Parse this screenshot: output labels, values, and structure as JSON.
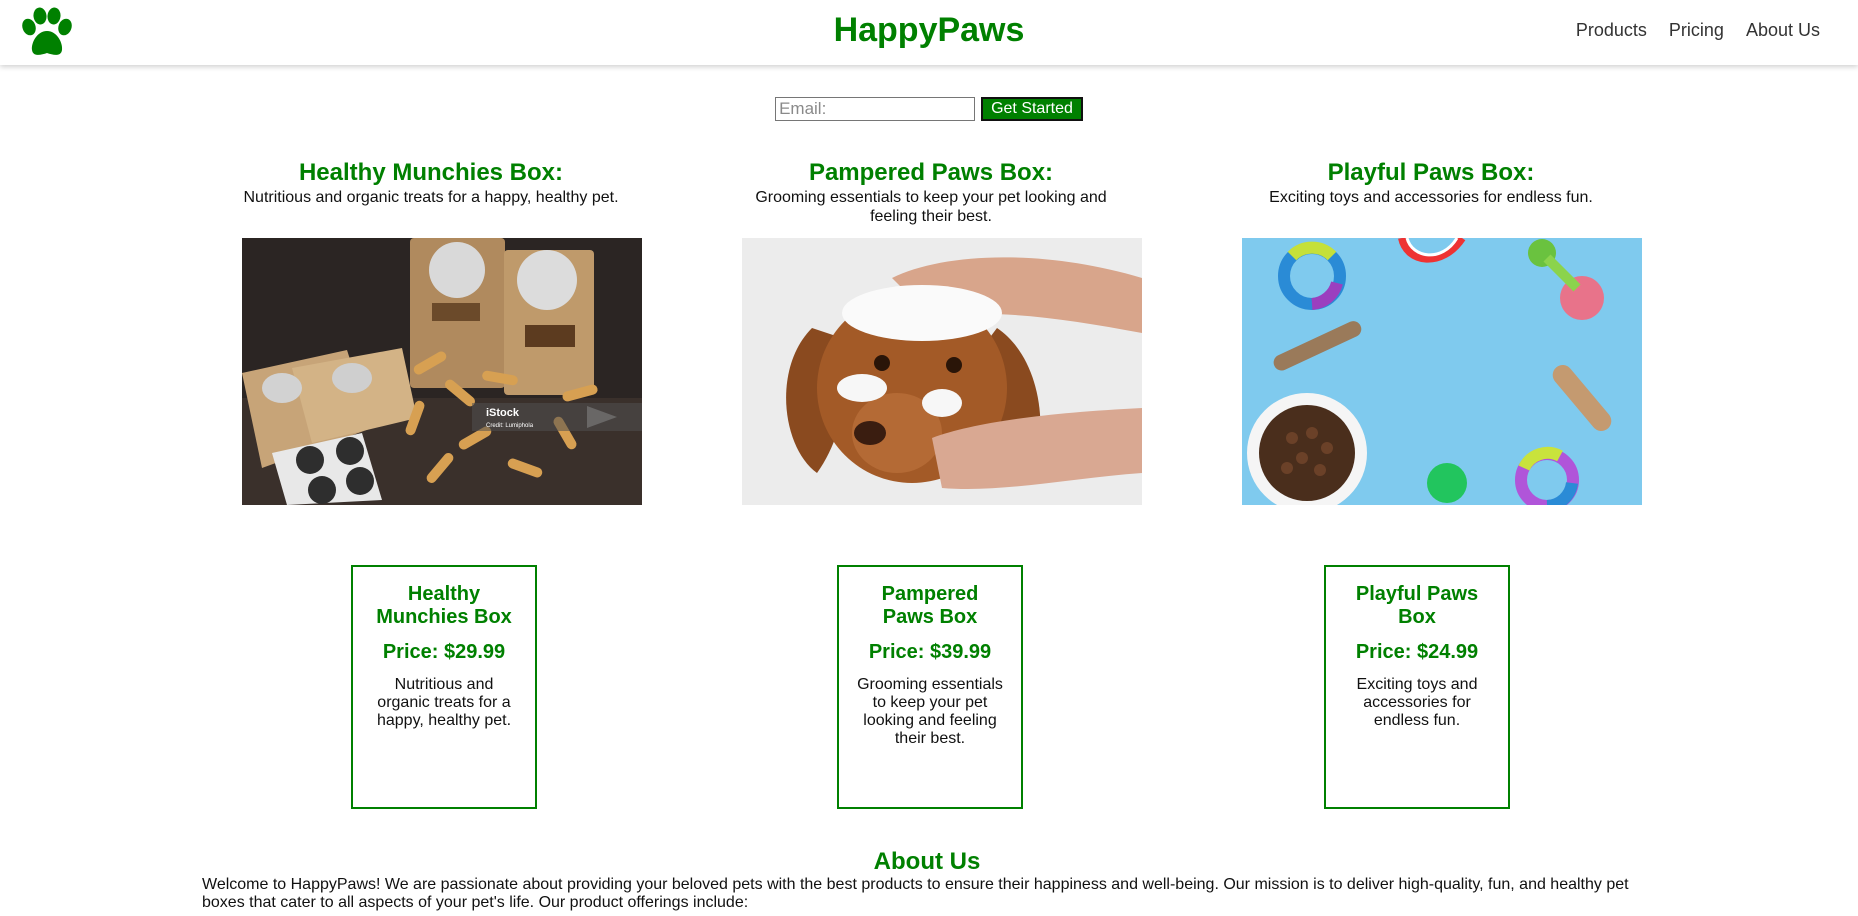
{
  "header": {
    "brand": "HappyPaws",
    "nav": [
      "Products",
      "Pricing",
      "About Us"
    ],
    "logo_icon": "paw-icon",
    "accent_color": "#008000"
  },
  "signup": {
    "email_placeholder": "Email:",
    "email_value": "",
    "button_label": "Get Started"
  },
  "products": [
    {
      "title": "Healthy Munchies Box:",
      "description": "Nutritious and organic treats for a happy, healthy pet.",
      "image": "pet-treats-photo",
      "watermark": "iStock",
      "watermark_credit": "Credit: Lumiphola"
    },
    {
      "title": "Pampered Paws Box:",
      "description": "Grooming essentials to keep your pet looking and feeling their best.",
      "image": "dog-bath-photo"
    },
    {
      "title": "Playful Paws Box:",
      "description": "Exciting toys and accessories for endless fun.",
      "image": "dog-toys-photo"
    }
  ],
  "pricing": [
    {
      "name": "Healthy Munchies Box",
      "price": "Price: $29.99",
      "description": "Nutritious and organic treats for a happy, healthy pet."
    },
    {
      "name": "Pampered Paws Box",
      "price": "Price: $39.99",
      "description": "Grooming essentials to keep your pet looking and feeling their best."
    },
    {
      "name": "Playful Paws Box",
      "price": "Price: $24.99",
      "description": "Exciting toys and accessories for endless fun."
    }
  ],
  "about": {
    "title": "About Us",
    "text": "Welcome to HappyPaws! We are passionate about providing your beloved pets with the best products to ensure their happiness and well-being. Our mission is to deliver high-quality, fun, and healthy pet boxes that cater to all aspects of your pet's life. Our product offerings include:"
  }
}
